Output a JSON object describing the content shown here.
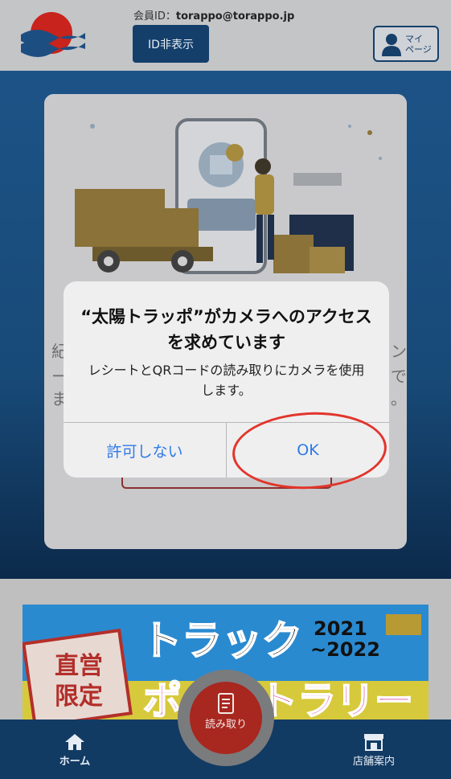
{
  "header": {
    "member_label": "会員ID：",
    "member_id": "torappo@torappo.jp",
    "id_hide_button": "ID非表示",
    "mypage_label": "マイ\nページ"
  },
  "background": {
    "left_fragment_1": "紀",
    "right_fragment_1": "ン",
    "left_fragment_2": "ー",
    "right_fragment_2": "で",
    "left_fragment_3": "ま",
    "right_fragment_3": "。"
  },
  "dialog": {
    "title": "“太陽トラッポ”がカメラへのアクセスを求めています",
    "message": "レシートとQRコードの読み取りにカメラを使用します。",
    "deny_button": "許可しない",
    "ok_button": "OK"
  },
  "banner": {
    "badge_line1": "直営",
    "badge_line2": "限定",
    "headline": "トラック",
    "years": "2021\n~2022",
    "subline": "ポイントラリー"
  },
  "tabbar": {
    "home": "ホーム",
    "scan": "読み取り",
    "stores": "店舗案内"
  },
  "colors": {
    "accent_blue": "#2e7be6",
    "nav_navy": "#123b63",
    "annotation_red": "#e2352b"
  }
}
